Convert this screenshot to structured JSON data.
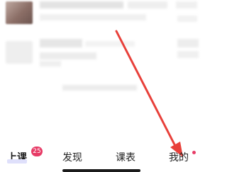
{
  "tabs": [
    {
      "label": "上课",
      "badge": "25",
      "active": true
    },
    {
      "label": "发现"
    },
    {
      "label": "课表"
    },
    {
      "label": "我的",
      "dot": true
    }
  ],
  "colors": {
    "accent": "#e73b66",
    "arrow": "#e8403a",
    "active_underline": "#dfe0fb"
  }
}
